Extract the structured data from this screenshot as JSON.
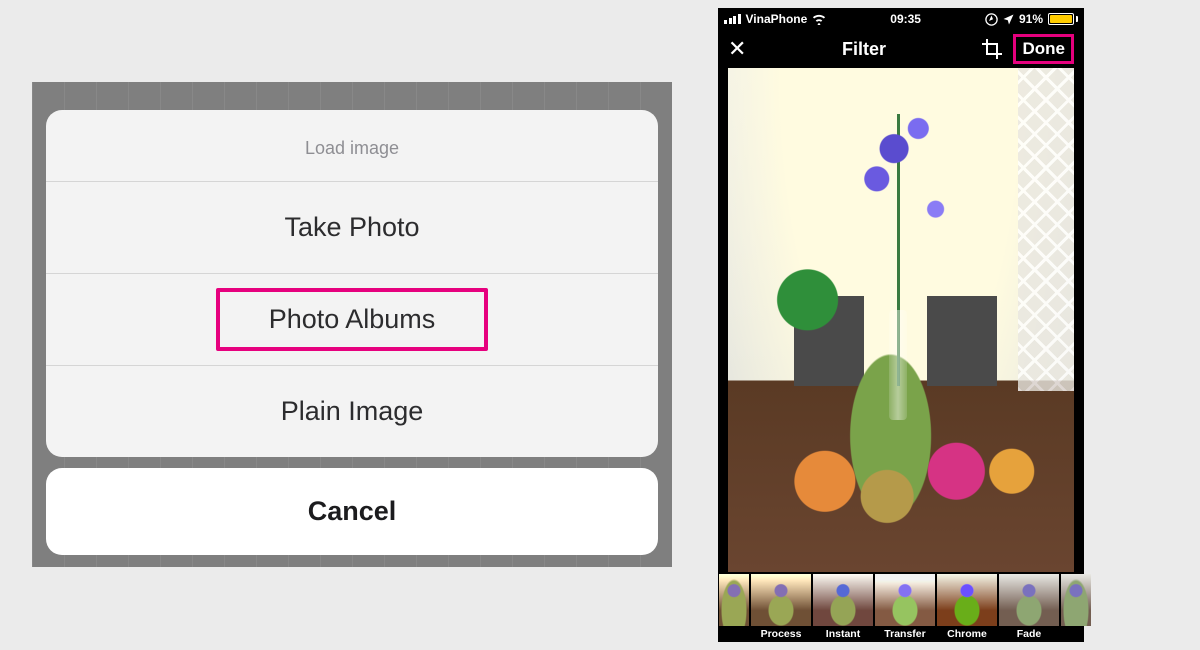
{
  "colors": {
    "highlight": "#e6007e",
    "battery_fill": "#ffcc00"
  },
  "action_sheet": {
    "title": "Load image",
    "options": [
      {
        "label": "Take Photo",
        "highlighted": false
      },
      {
        "label": "Photo Albums",
        "highlighted": true
      },
      {
        "label": "Plain Image",
        "highlighted": false
      }
    ],
    "cancel_label": "Cancel"
  },
  "phone": {
    "status": {
      "carrier": "VinaPhone",
      "time": "09:35",
      "battery_percent": "91%"
    },
    "nav": {
      "close": "✕",
      "title": "Filter",
      "done": "Done"
    },
    "filters": [
      {
        "label": "",
        "tone": "warm"
      },
      {
        "label": "Process",
        "tone": "warm"
      },
      {
        "label": "Instant",
        "tone": "cool"
      },
      {
        "label": "Transfer",
        "tone": "bright"
      },
      {
        "label": "Chrome",
        "tone": "vivid"
      },
      {
        "label": "Fade",
        "tone": "fade"
      },
      {
        "label": "",
        "tone": "fade"
      }
    ]
  }
}
